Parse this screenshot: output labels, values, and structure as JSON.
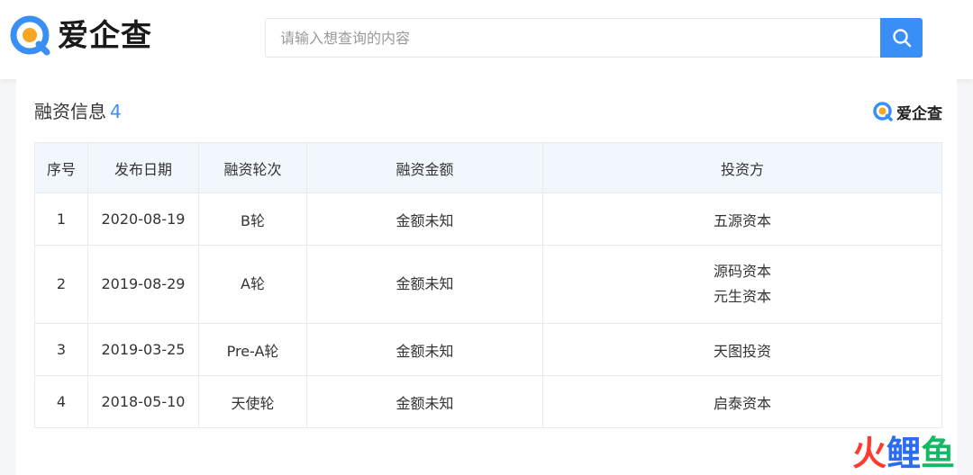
{
  "brand": {
    "name": "爱企查",
    "mini_name": "爱企查",
    "accent": "#3a8ff6",
    "logo_orange": "#f5a623"
  },
  "search": {
    "placeholder": "请输入想查询的内容",
    "value": "",
    "button_icon": "search-icon"
  },
  "section": {
    "title": "融资信息",
    "count": "4"
  },
  "table": {
    "headers": [
      "序号",
      "发布日期",
      "融资轮次",
      "融资金额",
      "投资方"
    ],
    "rows": [
      {
        "index": "1",
        "date": "2020-08-19",
        "round": "B轮",
        "amount": "金额未知",
        "investors": [
          "五源资本"
        ]
      },
      {
        "index": "2",
        "date": "2019-08-29",
        "round": "A轮",
        "amount": "金额未知",
        "investors": [
          "源码资本",
          "元生资本"
        ]
      },
      {
        "index": "3",
        "date": "2019-03-25",
        "round": "Pre-A轮",
        "amount": "金额未知",
        "investors": [
          "天图投资"
        ]
      },
      {
        "index": "4",
        "date": "2018-05-10",
        "round": "天使轮",
        "amount": "金额未知",
        "investors": [
          "启泰资本"
        ]
      }
    ]
  },
  "watermark": {
    "chars": [
      "火",
      "鲤",
      "鱼"
    ],
    "colors": [
      "#ff3b30",
      "#2a6df4",
      "#16b866"
    ]
  }
}
